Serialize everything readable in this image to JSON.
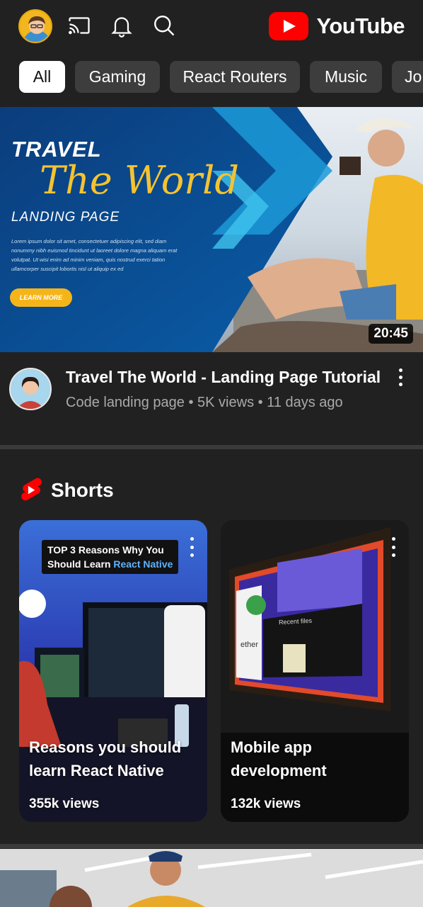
{
  "header": {
    "logo_text": "YouTube",
    "icons": [
      "account-avatar",
      "cast-icon",
      "notifications-icon",
      "search-icon"
    ]
  },
  "chips": [
    {
      "label": "All",
      "active": true
    },
    {
      "label": "Gaming",
      "active": false
    },
    {
      "label": "React Routers",
      "active": false
    },
    {
      "label": "Music",
      "active": false
    },
    {
      "label": "Jo",
      "active": false
    }
  ],
  "video": {
    "thumbnail_text": {
      "line1": "TRAVEL",
      "line2": "The World",
      "line3": "LANDING PAGE",
      "body": "Lorem ipsum dolor sit amet, consectetuer adipiscing elit, sed diam nonummy nibh euismod tincidunt ut laoreet dolore magna aliquam erat volutpat. Ut wisi enim ad minim veniam, quis nostrud exerci tation ullamcorper suscipit lobortis nisl ut aliquip ex ed",
      "cta": "LEARN MORE"
    },
    "duration": "20:45",
    "title": "Travel The World - Landing Page Tutorial",
    "subtitle": "Code landing page • 5K views • 11 days ago"
  },
  "shorts": {
    "section_title": "Shorts",
    "items": [
      {
        "caption_line1": "TOP 3 Reasons Why You",
        "caption_line2a": "Should Learn ",
        "caption_line2b": "React Native",
        "title": "Reasons you should learn React Native",
        "views": "355k views"
      },
      {
        "title": "Mobile app development",
        "views": "132k views",
        "screen_text_1": "Recent files",
        "screen_text_2": "ether"
      }
    ]
  },
  "colors": {
    "background": "#212121",
    "chip_bg": "#3d3d3d",
    "chip_active_bg": "#ffffff",
    "brand_red": "#ff0000",
    "secondary_text": "#aaaaaa"
  }
}
